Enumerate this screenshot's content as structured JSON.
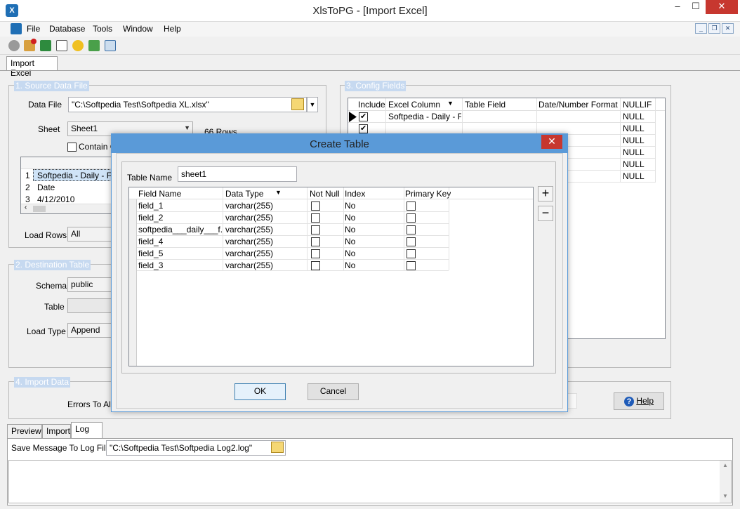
{
  "window": {
    "title": "XlsToPG - [Import Excel]",
    "app_icon": "app-logo-icon",
    "min": "–",
    "max": "☐",
    "close": "✕"
  },
  "menu": [
    "File",
    "Database",
    "Tools",
    "Window",
    "Help"
  ],
  "mdi": {
    "min": "_",
    "restore": "❐",
    "close": "✕"
  },
  "toolbar_icons": [
    "connect-icon",
    "disconnect-icon",
    "excel-icon",
    "report-icon",
    "wizard-icon",
    "refresh-icon",
    "table-icon"
  ],
  "doc_tab": "Import Excel",
  "source": {
    "title": "1. Source Data File",
    "data_file_label": "Data File",
    "data_file_value": "\"C:\\Softpedia Test\\Softpedia XL.xlsx\"",
    "sheet_label": "Sheet",
    "sheet_value": "Sheet1",
    "rows_info": "66 Rows",
    "contain_label": "Contain C",
    "preview_rows": [
      {
        "num": "1",
        "value": "Softpedia - Daily - Floa"
      },
      {
        "num": "2",
        "value": "Date"
      },
      {
        "num": "3",
        "value": "4/12/2010"
      }
    ],
    "load_rows_label": "Load Rows",
    "load_rows_value": "All"
  },
  "destination": {
    "title": "2. Destination Table",
    "schema_label": "Schema",
    "schema_value": "public",
    "table_label": "Table",
    "table_value": "",
    "load_type_label": "Load Type",
    "load_type_value": "Append"
  },
  "config": {
    "title": "3. Config Fields",
    "columns": [
      "Include",
      "Excel Column",
      "Table Field",
      "Date/Number Format",
      "NULLIF"
    ],
    "rows": [
      {
        "checked": true,
        "excel": "Softpedia - Daily - Fl...",
        "nullif": "NULL"
      },
      {
        "checked": true,
        "excel": "",
        "nullif": "NULL"
      },
      {
        "checked": false,
        "excel": "",
        "nullif": "NULL"
      },
      {
        "checked": false,
        "excel": "",
        "nullif": "NULL"
      },
      {
        "checked": false,
        "excel": "",
        "nullif": "NULL"
      },
      {
        "checked": false,
        "excel": "",
        "nullif": "NULL"
      }
    ]
  },
  "import_data": {
    "title": "4. Import Data",
    "errors_label": "Errors To Allo",
    "help_label": "Help"
  },
  "bottom_tabs": [
    "Preview",
    "Import",
    "Log"
  ],
  "log": {
    "save_label": "Save Message To Log File",
    "save_value": "\"C:\\Softpedia Test\\Softpedia Log2.log\""
  },
  "dialog": {
    "title": "Create Table",
    "close": "✕",
    "table_name_label": "Table Name",
    "table_name_value": "sheet1",
    "columns": [
      "Field Name",
      "Data Type",
      "Not Null",
      "Index",
      "Primary Key"
    ],
    "rows": [
      {
        "field": "field_1",
        "type": "varchar(255)",
        "index": "No"
      },
      {
        "field": "field_2",
        "type": "varchar(255)",
        "index": "No"
      },
      {
        "field": "softpedia___daily___f...",
        "type": "varchar(255)",
        "index": "No"
      },
      {
        "field": "field_4",
        "type": "varchar(255)",
        "index": "No"
      },
      {
        "field": "field_5",
        "type": "varchar(255)",
        "index": "No"
      },
      {
        "field": "field_3",
        "type": "varchar(255)",
        "index": "No"
      }
    ],
    "add": "+",
    "remove": "−",
    "ok": "OK",
    "cancel": "Cancel"
  }
}
